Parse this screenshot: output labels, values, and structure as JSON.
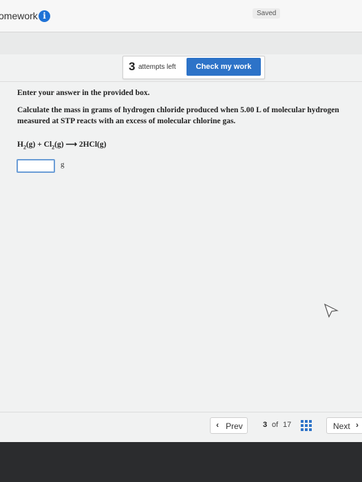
{
  "header": {
    "title": "omework",
    "info_icon": "info-icon",
    "saved_label": "Saved"
  },
  "toolbar": {
    "attempts_count": "3",
    "attempts_label": "attempts left",
    "check_label": "Check my work"
  },
  "question": {
    "instruction": "Enter your answer in the provided box.",
    "prompt": "Calculate the mass in grams of hydrogen chloride produced when 5.00 L of molecular hydrogen measured at STP reacts with an excess of molecular chlorine gas.",
    "equation": {
      "r1": "H",
      "r1_sub": "2",
      "r1_state": "(g) + Cl",
      "r2_sub": "2",
      "r2_state": "(g)",
      "arrow": " ⟶ ",
      "product": "2HCl(g)"
    },
    "answer_value": "",
    "unit": "g"
  },
  "footer": {
    "prev_label": "Prev",
    "page_current": "3",
    "page_of": "of",
    "page_total": "17",
    "next_label": "Next"
  },
  "colors": {
    "accent": "#2d73c8",
    "info": "#1f72d6",
    "bottom_bar": "#2b2c2e"
  }
}
